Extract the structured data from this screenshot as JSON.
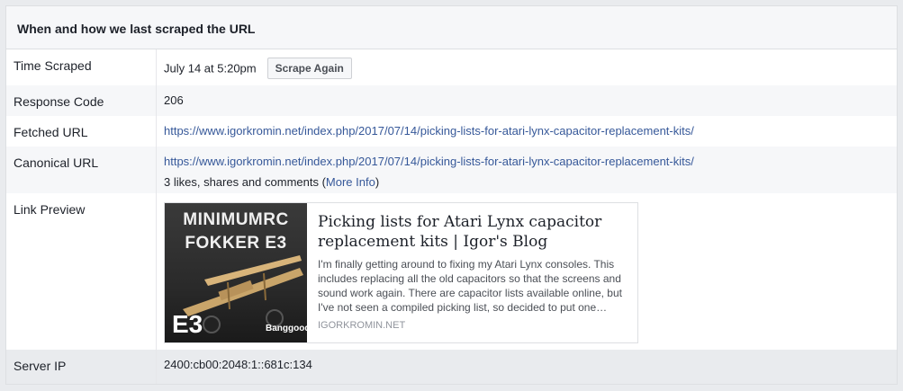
{
  "header": {
    "title": "When and how we last scraped the URL"
  },
  "rows": {
    "time_scraped": {
      "label": "Time Scraped",
      "value": "July 14 at 5:20pm",
      "button": "Scrape Again"
    },
    "response_code": {
      "label": "Response Code",
      "value": "206"
    },
    "fetched_url": {
      "label": "Fetched URL",
      "value": "https://www.igorkromin.net/index.php/2017/07/14/picking-lists-for-atari-lynx-capacitor-replacement-kits/"
    },
    "canonical_url": {
      "label": "Canonical URL",
      "value": "https://www.igorkromin.net/index.php/2017/07/14/picking-lists-for-atari-lynx-capacitor-replacement-kits/",
      "engagement_prefix": "3 likes, shares and comments (",
      "more_info": "More Info",
      "engagement_suffix": ")"
    },
    "link_preview": {
      "label": "Link Preview",
      "image_text_1": "MINIMUMRC",
      "image_text_2": "FOKKER E3",
      "image_text_3": "E3",
      "image_text_4": "Banggood",
      "title": "Picking lists for Atari Lynx capacitor replacement kits | Igor's Blog",
      "description": "I'm finally getting around to fixing my Atari Lynx consoles. This includes replacing all the old capacitors so that the screens and sound work again. There are capacitor lists available online, but I've not seen a compiled picking list, so decided to put one…",
      "domain": "IGORKROMIN.NET"
    },
    "server_ip": {
      "label": "Server IP",
      "value": "2400:cb00:2048:1::681c:134"
    }
  },
  "colors": {
    "link": "#365899",
    "header_bg": "#f6f7f9",
    "border": "#dddfe2"
  }
}
